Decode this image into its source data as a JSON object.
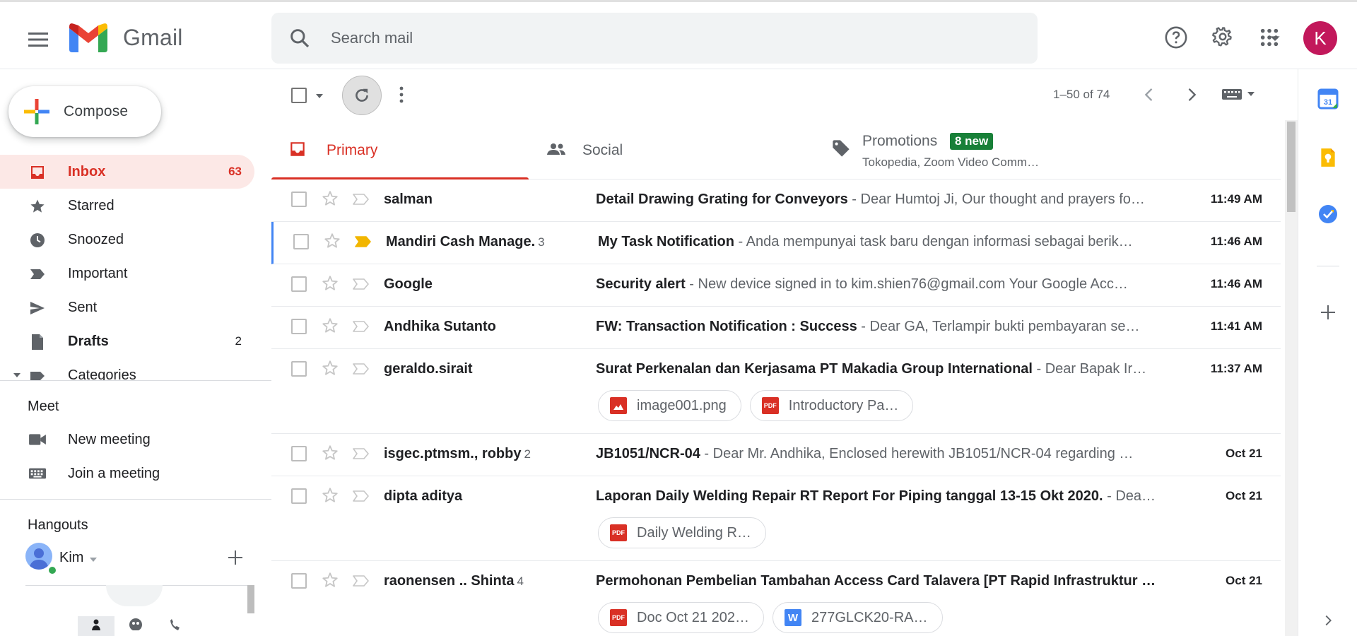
{
  "header": {
    "app_name": "Gmail",
    "search_placeholder": "Search mail",
    "avatar_initial": "K"
  },
  "sidebar": {
    "compose_label": "Compose",
    "items": [
      {
        "label": "Inbox",
        "count": "63",
        "icon": "inbox-icon",
        "active": true
      },
      {
        "label": "Starred",
        "count": "",
        "icon": "star-icon"
      },
      {
        "label": "Snoozed",
        "count": "",
        "icon": "clock-icon"
      },
      {
        "label": "Important",
        "count": "",
        "icon": "important-icon"
      },
      {
        "label": "Sent",
        "count": "",
        "icon": "send-icon"
      },
      {
        "label": "Drafts",
        "count": "2",
        "icon": "draft-icon"
      },
      {
        "label": "Categories",
        "count": "",
        "icon": "label-icon"
      }
    ],
    "meet": {
      "title": "Meet",
      "new_meeting": "New meeting",
      "join_meeting": "Join a meeting"
    },
    "hangouts": {
      "title": "Hangouts",
      "user_name": "Kim"
    }
  },
  "toolbar": {
    "pagination": "1–50 of 74"
  },
  "tabs": {
    "primary": "Primary",
    "social": "Social",
    "promotions": "Promotions",
    "promotions_badge": "8 new",
    "promotions_sub": "Tokopedia, Zoom Video Comm…"
  },
  "emails": [
    {
      "sender": "salman",
      "count": "",
      "subject": "Detail Drawing Grating for Conveyors",
      "snippet": " - Dear Humtoj Ji, Our thought and prayers fo…",
      "time": "11:49 AM",
      "important": false,
      "attachments": []
    },
    {
      "sender": "Mandiri Cash Manage.",
      "count": "3",
      "subject": "My Task Notification",
      "snippet": " - Anda mempunyai task baru dengan informasi sebagai berik…",
      "time": "11:46 AM",
      "important": true,
      "attachments": []
    },
    {
      "sender": "Google",
      "count": "",
      "subject": "Security alert",
      "snippet": " - New device signed in to kim.shien76@gmail.com Your Google Acc…",
      "time": "11:46 AM",
      "important": false,
      "attachments": []
    },
    {
      "sender": "Andhika Sutanto",
      "count": "",
      "subject": "FW: Transaction Notification : Success",
      "snippet": " - Dear GA, Terlampir bukti pembayaran se…",
      "time": "11:41 AM",
      "important": false,
      "attachments": []
    },
    {
      "sender": "geraldo.sirait",
      "count": "",
      "subject": "Surat Perkenalan dan Kerjasama PT Makadia Group International",
      "snippet": " - Dear Bapak Ir…",
      "time": "11:37 AM",
      "important": false,
      "attachments": [
        {
          "name": "image001.png",
          "type": "image"
        },
        {
          "name": "Introductory Pa…",
          "type": "pdf"
        }
      ]
    },
    {
      "sender": "isgec.ptmsm., robby",
      "count": "2",
      "subject": "JB1051/NCR-04",
      "snippet": " - Dear Mr. Andhika, Enclosed herewith JB1051/NCR-04 regarding …",
      "time": "Oct 21",
      "important": false,
      "attachments": []
    },
    {
      "sender": "dipta aditya",
      "count": "",
      "subject": "Laporan Daily Welding Repair RT Report For Piping tanggal 13-15 Okt 2020.",
      "snippet": " - Dea…",
      "time": "Oct 21",
      "important": false,
      "attachments": [
        {
          "name": "Daily Welding R…",
          "type": "pdf"
        }
      ]
    },
    {
      "sender": "raonensen .. Shinta",
      "count": "4",
      "subject": "Permohonan Pembelian Tambahan Access Card Talavera [PT Rapid Infrastruktur …",
      "snippet": "",
      "time": "Oct 21",
      "important": false,
      "attachments": [
        {
          "name": "Doc Oct 21 202…",
          "type": "pdf"
        },
        {
          "name": "277GLCK20-RA…",
          "type": "word"
        }
      ]
    }
  ],
  "colors": {
    "accent_red": "#d93025",
    "active_bg": "#fce8e6",
    "badge_green": "#188038",
    "avatar": "#c2185b",
    "important_yellow": "#f2b600"
  }
}
